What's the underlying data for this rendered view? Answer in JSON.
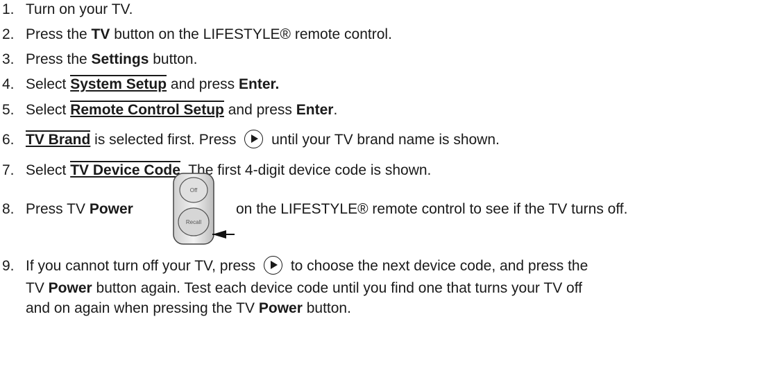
{
  "steps": [
    {
      "num": "1.",
      "parts": [
        "Turn on your TV."
      ]
    },
    {
      "num": "2.",
      "pre": "Press the ",
      "bold": "TV",
      "post": " button on the LIFESTYLE® remote control."
    },
    {
      "num": "3.",
      "pre": "Press the ",
      "bold": "Settings",
      "post": " button."
    },
    {
      "num": "4.",
      "pre": "Select ",
      "menu": "System Setup",
      "mid": " and press ",
      "bold": "Enter."
    },
    {
      "num": "5.",
      "pre": "Select ",
      "menu": "Remote Control Setup",
      "mid": " and press ",
      "bold": "Enter",
      "post": "."
    },
    {
      "num": "6.",
      "menu": "TV Brand",
      "mid": " is selected first. Press ",
      "post": " until your TV brand name is shown."
    },
    {
      "num": "7.",
      "pre": "Select ",
      "menu": "TV Device Code",
      "post": ". The first 4-digit device code is shown."
    },
    {
      "num": "8.",
      "pre": "Press TV ",
      "bold": "Power",
      "post": "on the LIFESTYLE® remote control to see if the TV turns off."
    },
    {
      "num": "9.",
      "pre": "If you cannot turn off your TV, press ",
      "post": " to choose the next device code, and press the",
      "line2_pre": "TV ",
      "line2_bold": "Power",
      "line2_post": " button again. Test each device code until you find one that turns your TV off",
      "line3_pre": "and on again when pressing the TV ",
      "line3_bold": "Power",
      "line3_post": " button."
    }
  ],
  "icons": {
    "play_button": "right-arrow-button-icon",
    "remote": "remote-power-button-icon"
  },
  "remote_labels": {
    "top": "Off",
    "bottom": "Recall"
  }
}
